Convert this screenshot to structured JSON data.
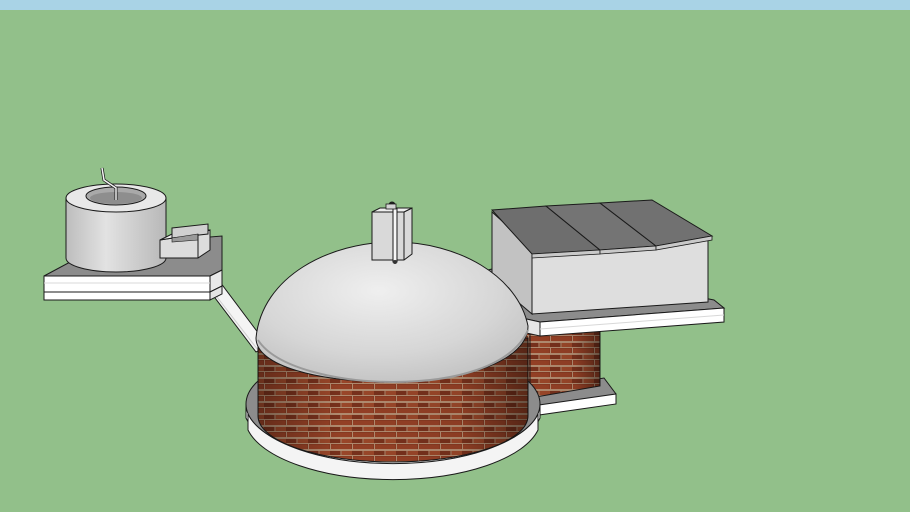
{
  "scene": {
    "sky_color": "#a9d3e6",
    "ground_color": "#92c08a",
    "outline_color": "#1a1a1a",
    "concrete_light": "#e4e4e4",
    "concrete_mid": "#c9c9c9",
    "concrete_dark": "#a8a8a8",
    "slab_top_color": "#8c8c8c",
    "slab_edge_color": "#ffffff",
    "brick_color": "#8a3b22",
    "mortar_color": "#c4a688",
    "cover_color": "#6e6e6e",
    "objects": [
      {
        "name": "inlet-tank",
        "label": ""
      },
      {
        "name": "inlet-pipe",
        "label": ""
      },
      {
        "name": "biogas-dome",
        "label": ""
      },
      {
        "name": "gas-outlet-chimney",
        "label": ""
      },
      {
        "name": "brick-digester-wall",
        "label": ""
      },
      {
        "name": "outlet-chamber",
        "label": ""
      },
      {
        "name": "outlet-cover-slabs",
        "label": ""
      }
    ]
  }
}
